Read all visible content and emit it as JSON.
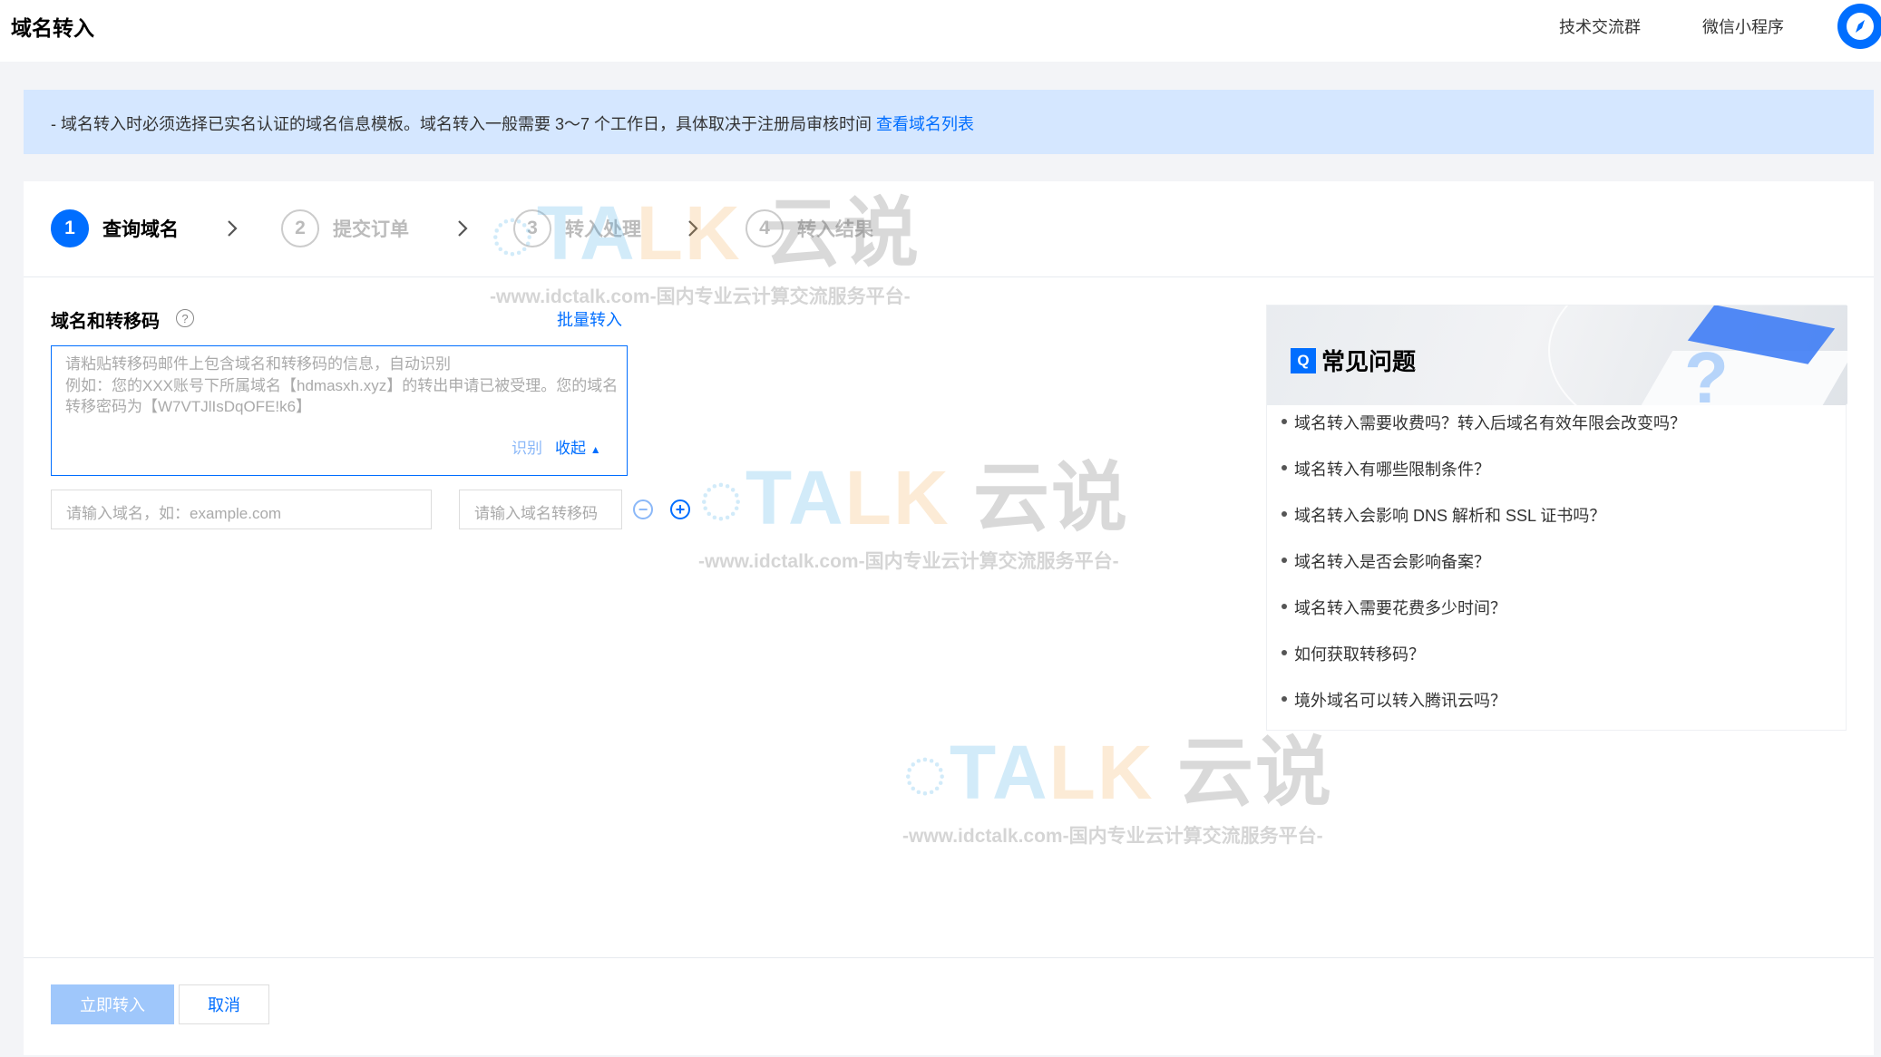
{
  "header": {
    "title": "域名转入",
    "links": [
      "技术交流群",
      "微信小程序"
    ]
  },
  "notice": {
    "text": "- 域名转入时必须选择已实名认证的域名信息模板。域名转入一般需要 3～7 个工作日，具体取决于注册局审核时间 ",
    "link": "查看域名列表"
  },
  "steps": [
    {
      "num": "1",
      "label": "查询域名"
    },
    {
      "num": "2",
      "label": "提交订单"
    },
    {
      "num": "3",
      "label": "转入处理"
    },
    {
      "num": "4",
      "label": "转入结果"
    }
  ],
  "form": {
    "label": "域名和转移码",
    "help": "?",
    "batch_link": "批量转入",
    "textarea_placeholder": "请粘贴转移码邮件上包含域名和转移码的信息，自动识别\n例如：您的XXX账号下所属域名【hdmasxh.xyz】的转出申请已被受理。您的域名转移密码为【W7VTJlIsDqOFE!k6】",
    "recognize": "识别",
    "collapse": "收起",
    "domain_placeholder": "请输入域名，如：example.com",
    "code_placeholder": "请输入域名转移码"
  },
  "buttons": {
    "submit": "立即转入",
    "cancel": "取消"
  },
  "faq": {
    "badge": "Q",
    "title": "常见问题",
    "items": [
      "域名转入需要收费吗？转入后域名有效年限会改变吗？",
      "域名转入有哪些限制条件？",
      "域名转入会影响 DNS 解析和 SSL 证书吗？",
      "域名转入是否会影响备案？",
      "域名转入需要花费多少时间？",
      "如何获取转移码？",
      "境外域名可以转入腾讯云吗？"
    ]
  },
  "watermark": {
    "logo_a": "TA",
    "logo_b": "LK",
    "logo_c": "云说",
    "sub": "-www.idctalk.com-国内专业云计算交流服务平台-"
  },
  "colors": {
    "primary": "#006eff",
    "notice_bg": "#d5e7ff",
    "disabled_btn": "#9fc7fb",
    "page_bg": "#f3f4f7"
  }
}
